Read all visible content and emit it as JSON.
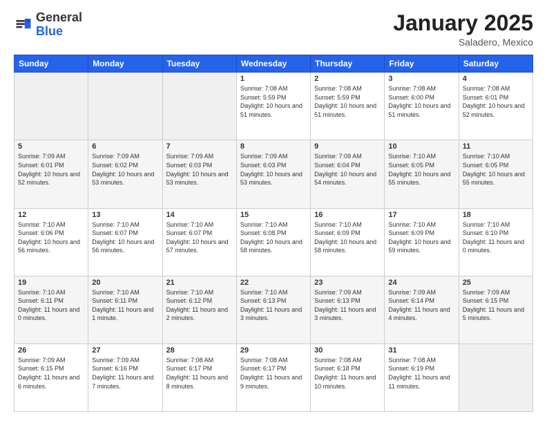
{
  "header": {
    "logo_general": "General",
    "logo_blue": "Blue",
    "title": "January 2025",
    "subtitle": "Saladero, Mexico"
  },
  "weekdays": [
    "Sunday",
    "Monday",
    "Tuesday",
    "Wednesday",
    "Thursday",
    "Friday",
    "Saturday"
  ],
  "weeks": [
    [
      {
        "day": "",
        "empty": true
      },
      {
        "day": "",
        "empty": true
      },
      {
        "day": "",
        "empty": true
      },
      {
        "day": "1",
        "sunrise": "7:08 AM",
        "sunset": "5:59 PM",
        "daylight": "10 hours and 51 minutes."
      },
      {
        "day": "2",
        "sunrise": "7:08 AM",
        "sunset": "5:59 PM",
        "daylight": "10 hours and 51 minutes."
      },
      {
        "day": "3",
        "sunrise": "7:08 AM",
        "sunset": "6:00 PM",
        "daylight": "10 hours and 51 minutes."
      },
      {
        "day": "4",
        "sunrise": "7:08 AM",
        "sunset": "6:01 PM",
        "daylight": "10 hours and 52 minutes."
      }
    ],
    [
      {
        "day": "5",
        "sunrise": "7:09 AM",
        "sunset": "6:01 PM",
        "daylight": "10 hours and 52 minutes."
      },
      {
        "day": "6",
        "sunrise": "7:09 AM",
        "sunset": "6:02 PM",
        "daylight": "10 hours and 53 minutes."
      },
      {
        "day": "7",
        "sunrise": "7:09 AM",
        "sunset": "6:03 PM",
        "daylight": "10 hours and 53 minutes."
      },
      {
        "day": "8",
        "sunrise": "7:09 AM",
        "sunset": "6:03 PM",
        "daylight": "10 hours and 53 minutes."
      },
      {
        "day": "9",
        "sunrise": "7:09 AM",
        "sunset": "6:04 PM",
        "daylight": "10 hours and 54 minutes."
      },
      {
        "day": "10",
        "sunrise": "7:10 AM",
        "sunset": "6:05 PM",
        "daylight": "10 hours and 55 minutes."
      },
      {
        "day": "11",
        "sunrise": "7:10 AM",
        "sunset": "6:05 PM",
        "daylight": "10 hours and 55 minutes."
      }
    ],
    [
      {
        "day": "12",
        "sunrise": "7:10 AM",
        "sunset": "6:06 PM",
        "daylight": "10 hours and 56 minutes."
      },
      {
        "day": "13",
        "sunrise": "7:10 AM",
        "sunset": "6:07 PM",
        "daylight": "10 hours and 56 minutes."
      },
      {
        "day": "14",
        "sunrise": "7:10 AM",
        "sunset": "6:07 PM",
        "daylight": "10 hours and 57 minutes."
      },
      {
        "day": "15",
        "sunrise": "7:10 AM",
        "sunset": "6:08 PM",
        "daylight": "10 hours and 58 minutes."
      },
      {
        "day": "16",
        "sunrise": "7:10 AM",
        "sunset": "6:09 PM",
        "daylight": "10 hours and 58 minutes."
      },
      {
        "day": "17",
        "sunrise": "7:10 AM",
        "sunset": "6:09 PM",
        "daylight": "10 hours and 59 minutes."
      },
      {
        "day": "18",
        "sunrise": "7:10 AM",
        "sunset": "6:10 PM",
        "daylight": "11 hours and 0 minutes."
      }
    ],
    [
      {
        "day": "19",
        "sunrise": "7:10 AM",
        "sunset": "6:11 PM",
        "daylight": "11 hours and 0 minutes."
      },
      {
        "day": "20",
        "sunrise": "7:10 AM",
        "sunset": "6:11 PM",
        "daylight": "11 hours and 1 minute."
      },
      {
        "day": "21",
        "sunrise": "7:10 AM",
        "sunset": "6:12 PM",
        "daylight": "11 hours and 2 minutes."
      },
      {
        "day": "22",
        "sunrise": "7:10 AM",
        "sunset": "6:13 PM",
        "daylight": "11 hours and 3 minutes."
      },
      {
        "day": "23",
        "sunrise": "7:09 AM",
        "sunset": "6:13 PM",
        "daylight": "11 hours and 3 minutes."
      },
      {
        "day": "24",
        "sunrise": "7:09 AM",
        "sunset": "6:14 PM",
        "daylight": "11 hours and 4 minutes."
      },
      {
        "day": "25",
        "sunrise": "7:09 AM",
        "sunset": "6:15 PM",
        "daylight": "11 hours and 5 minutes."
      }
    ],
    [
      {
        "day": "26",
        "sunrise": "7:09 AM",
        "sunset": "6:15 PM",
        "daylight": "11 hours and 6 minutes."
      },
      {
        "day": "27",
        "sunrise": "7:09 AM",
        "sunset": "6:16 PM",
        "daylight": "11 hours and 7 minutes."
      },
      {
        "day": "28",
        "sunrise": "7:08 AM",
        "sunset": "6:17 PM",
        "daylight": "11 hours and 8 minutes."
      },
      {
        "day": "29",
        "sunrise": "7:08 AM",
        "sunset": "6:17 PM",
        "daylight": "11 hours and 9 minutes."
      },
      {
        "day": "30",
        "sunrise": "7:08 AM",
        "sunset": "6:18 PM",
        "daylight": "11 hours and 10 minutes."
      },
      {
        "day": "31",
        "sunrise": "7:08 AM",
        "sunset": "6:19 PM",
        "daylight": "11 hours and 11 minutes."
      },
      {
        "day": "",
        "empty": true
      }
    ]
  ]
}
